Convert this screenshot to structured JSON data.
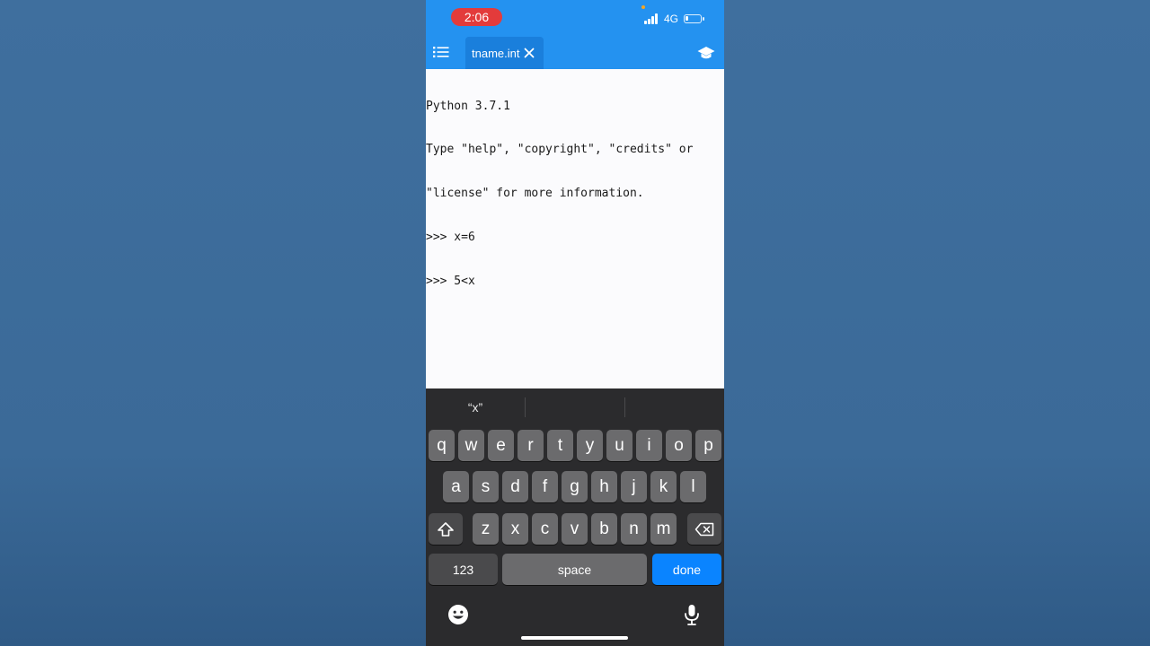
{
  "status_bar": {
    "time": "2:06",
    "network": "4G",
    "battery_level": 0.2,
    "accent_time_color": "#e33b3b"
  },
  "header": {
    "menu_icon": "list-icon",
    "tab_label": "tname.int",
    "tab_close_icon": "close-icon",
    "right_icon": "graduation-cap-icon",
    "bar_color": "#2492f0"
  },
  "console": {
    "lines": [
      "Python 3.7.1",
      "Type \"help\", \"copyright\", \"credits\" or",
      "\"license\" for more information.",
      ">>> x=6",
      ">>> 5<x"
    ]
  },
  "keyboard": {
    "suggestions": [
      "“x”",
      "",
      ""
    ],
    "row1": [
      "q",
      "w",
      "e",
      "r",
      "t",
      "y",
      "u",
      "i",
      "o",
      "p"
    ],
    "row2": [
      "a",
      "s",
      "d",
      "f",
      "g",
      "h",
      "j",
      "k",
      "l"
    ],
    "row3": [
      "z",
      "x",
      "c",
      "v",
      "b",
      "n",
      "m"
    ],
    "shift_icon": "shift-icon",
    "backspace_icon": "backspace-icon",
    "numbers_label": "123",
    "space_label": "space",
    "done_label": "done",
    "emoji_icon": "emoji-icon",
    "mic_icon": "microphone-icon",
    "done_color": "#0a84ff"
  }
}
